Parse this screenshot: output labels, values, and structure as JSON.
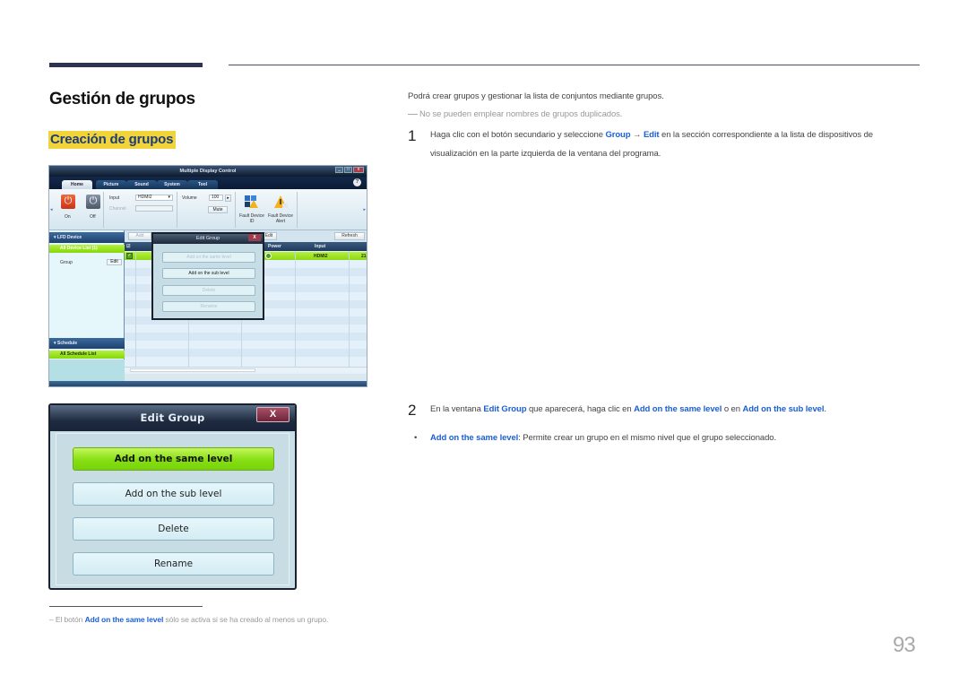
{
  "header": {
    "page_title": "Gestión de grupos",
    "section_title": "Creación de grupos"
  },
  "content": {
    "intro": "Podrá crear grupos y gestionar la lista de conjuntos mediante grupos.",
    "note": "No se pueden emplear nombres de grupos duplicados.",
    "step1": {
      "number": "1",
      "text_a": "Haga clic con el botón secundario y seleccione ",
      "kw_group": "Group",
      "arrow": " → ",
      "kw_edit": "Edit",
      "text_b": " en la sección correspondiente a la lista de dispositivos de",
      "text_c": "visualización en la parte izquierda de la ventana del programa."
    },
    "step2": {
      "number": "2",
      "text_a": "En la ventana ",
      "kw_edit_group": "Edit Group",
      "text_b": " que aparecerá, haga clic en ",
      "kw_same": "Add on the same level",
      "text_c": " o en ",
      "kw_sub": "Add on the sub level",
      "text_d": "."
    },
    "bullet": {
      "marker": "•",
      "kw": "Add on the same level",
      "text": ": Permite crear un grupo en el mismo nivel que el grupo seleccionado."
    },
    "footnote": {
      "dash": "–",
      "text_a": "El botón ",
      "kw": "Add on the same level",
      "text_b": " sólo se activa si se ha creado al menos un grupo."
    },
    "page_number": "93"
  },
  "app": {
    "title": "Multiple Display Control",
    "window_buttons": [
      "_",
      "□",
      "x"
    ],
    "tabs": [
      "Home",
      "Picture",
      "Sound",
      "System",
      "Tool"
    ],
    "active_tab": "Home",
    "help": "?",
    "ribbon": {
      "on_label": "On",
      "off_label": "Off",
      "input_label": "Input",
      "input_value": "HDMI2",
      "channel_label": "Channel",
      "volume_label": "Volume",
      "volume_value": "100",
      "mute_label": "Mute",
      "fault_id_label": "Fault Device ID",
      "fault_alert_label": "Fault Device Alert"
    },
    "sidebar": {
      "lfd_header": "LFD Device",
      "all_devices": "All Device List (1)",
      "group_item": "Group",
      "edit_button": "Edit",
      "schedule_header": "Schedule",
      "all_schedule": "All Schedule List"
    },
    "grid": {
      "add_button": "Add",
      "edit_button": "Edit",
      "refresh_button": "Refresh",
      "col_power": "Power",
      "col_input": "Input",
      "row_input": "HDMI2",
      "row_extra": "21"
    },
    "mini_dialog": {
      "title": "Edit Group",
      "close": "X",
      "buttons": [
        "Add on the same level",
        "Add on the sub level",
        "Delete",
        "Rename"
      ]
    }
  },
  "edit_group_dialog": {
    "title": "Edit Group",
    "close": "X",
    "buttons": {
      "same_level": "Add on the same level",
      "sub_level": "Add on the sub level",
      "delete": "Delete",
      "rename": "Rename"
    }
  }
}
